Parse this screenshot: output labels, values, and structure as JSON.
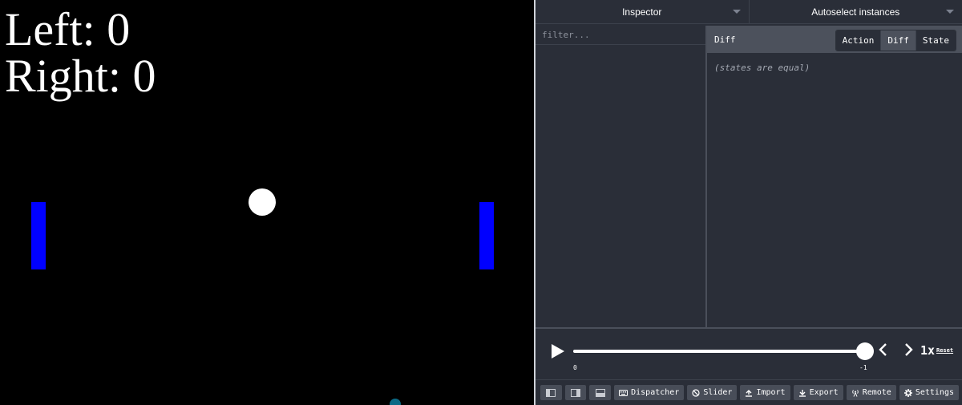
{
  "game": {
    "score_left": "Left: 0",
    "score_right": "Right: 0"
  },
  "colors": {
    "paddle": "#0000ff",
    "ball": "#ffffff",
    "panel_bg": "#2a2e38",
    "panel_header": "#4c515c"
  },
  "devtools": {
    "monitor_select": "Inspector",
    "instance_select": "Autoselect instances",
    "filter_placeholder": "filter...",
    "detail_title": "Diff",
    "tabs": [
      {
        "label": "Action",
        "icon": "",
        "active": false
      },
      {
        "label": "Diff",
        "icon": "",
        "active": true
      },
      {
        "label": "State",
        "icon": "",
        "active": false
      }
    ],
    "diff_message": "(states are equal)",
    "slider": {
      "min_label": "0",
      "max_label": "-1",
      "position": 1.0,
      "speed": "1x",
      "reset_label": "Reset"
    },
    "buttons": [
      {
        "label": "Dispatcher",
        "icon": "keyboard-icon"
      },
      {
        "label": "Slider",
        "icon": "slider-icon"
      },
      {
        "label": "Import",
        "icon": "import-icon"
      },
      {
        "label": "Export",
        "icon": "export-icon"
      },
      {
        "label": "Remote",
        "icon": "remote-icon"
      },
      {
        "label": "Settings",
        "icon": "gear-icon"
      }
    ]
  }
}
